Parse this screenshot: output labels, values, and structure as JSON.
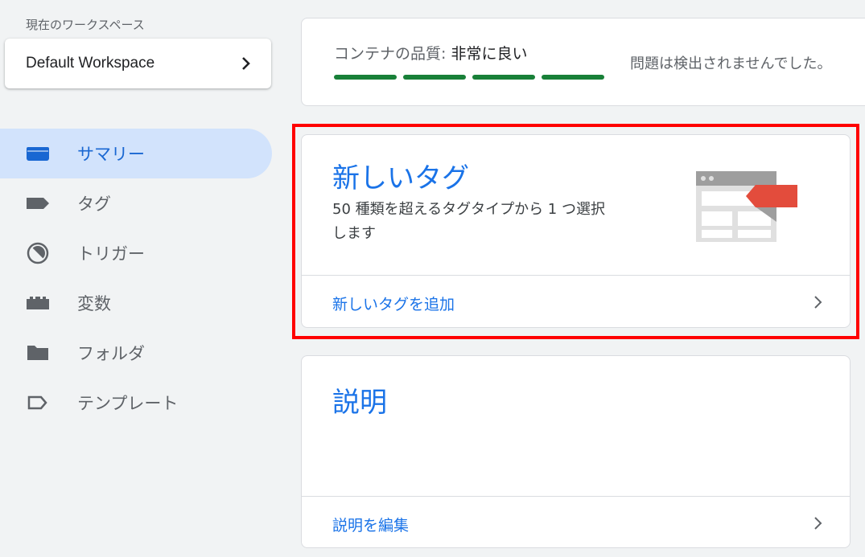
{
  "workspace": {
    "label": "現在のワークスペース",
    "name": "Default Workspace"
  },
  "nav": {
    "items": [
      {
        "label": "サマリー",
        "icon": "summary-icon",
        "active": true
      },
      {
        "label": "タグ",
        "icon": "tag-icon"
      },
      {
        "label": "トリガー",
        "icon": "trigger-icon"
      },
      {
        "label": "変数",
        "icon": "variables-icon"
      },
      {
        "label": "フォルダ",
        "icon": "folder-icon"
      },
      {
        "label": "テンプレート",
        "icon": "template-icon"
      }
    ]
  },
  "quality": {
    "label": "コンテナの品質: ",
    "value": "非常に良い",
    "bars_filled": 4,
    "bars_total": 4,
    "bar_color": "#188038",
    "message": "問題は検出されませんでした。"
  },
  "new_tag": {
    "title": "新しいタグ",
    "description": "50 種類を超えるタグタイプから 1 つ選択します",
    "link": "新しいタグを追加"
  },
  "description_card": {
    "title": "説明",
    "link": "説明を編集"
  },
  "colors": {
    "accent": "#1a73e8",
    "active_bg": "#d2e3fc",
    "highlight": "#ff0000"
  }
}
